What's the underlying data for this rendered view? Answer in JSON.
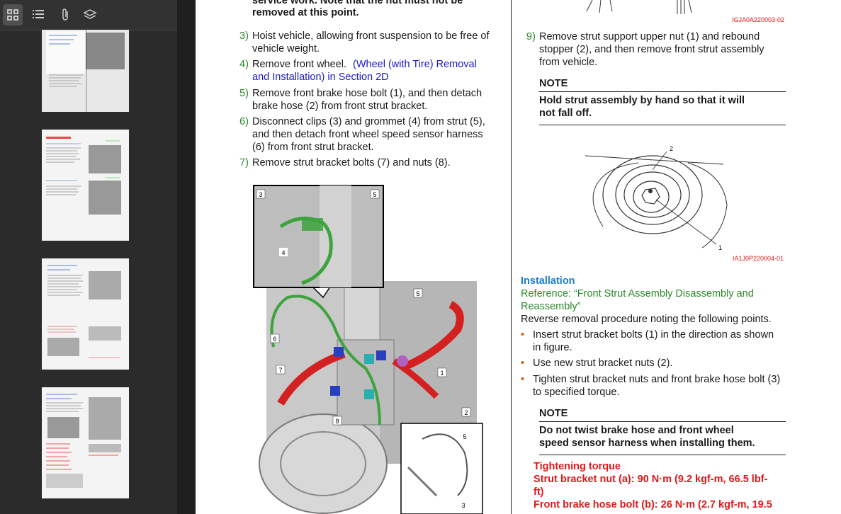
{
  "toolbar": {
    "icons": [
      "thumbnails-icon",
      "outline-icon",
      "attachment-icon",
      "layers-icon"
    ]
  },
  "doc": {
    "top_cut": "service work. Note that the nut must not be",
    "top_bold": "removed at this point.",
    "steps_left": [
      {
        "num": "3)",
        "lines": [
          "Hoist vehicle, allowing front suspension to be free of",
          "vehicle weight."
        ]
      },
      {
        "num": "4)",
        "text": "Remove front wheel.",
        "link1": "(Wheel (with Tire) Removal",
        "link2": "and Installation) in Section 2D"
      },
      {
        "num": "5)",
        "lines": [
          "Remove front brake hose bolt (1), and then detach",
          "brake hose (2) from front strut bracket."
        ]
      },
      {
        "num": "6)",
        "lines": [
          "Disconnect clips (3) and grommet (4) from strut (5),",
          "and then detach front wheel speed sensor harness",
          "(6) from front strut bracket."
        ]
      },
      {
        "num": "7)",
        "lines": [
          "Remove strut bracket bolts (7) and nuts (8)."
        ]
      }
    ],
    "figure_labels": [
      "3",
      "5",
      "4",
      "5",
      "6",
      "7",
      "1",
      "2",
      "8",
      "5",
      "3"
    ],
    "fig_code_top": "IGJA0A220003-02",
    "step9": {
      "num": "9)",
      "lines": [
        "Remove strut support upper nut (1) and rebound",
        "stopper (2), and then remove front strut assembly",
        "from vehicle."
      ]
    },
    "note1": {
      "title": "NOTE",
      "lines": [
        "Hold strut assembly by hand so that it will",
        "not fall off."
      ]
    },
    "fig2_labels": [
      "2",
      "1"
    ],
    "fig_code_mid": "IA1J0P220004-01",
    "install_title": "Installation",
    "reference": [
      "Reference: “Front Strut Assembly Disassembly and",
      "Reassembly”"
    ],
    "reverse": "Reverse removal procedure noting the following points.",
    "bullets": [
      [
        "Insert strut bracket bolts (1) in the direction as shown",
        "in figure."
      ],
      [
        "Use new strut bracket nuts (2)."
      ],
      [
        "Tighten strut bracket nuts and front brake hose bolt (3)",
        "to specified torque."
      ]
    ],
    "note2": {
      "title": "NOTE",
      "lines": [
        "Do not twist brake hose and front wheel",
        "speed sensor harness when installing them."
      ]
    },
    "torque": {
      "title": "Tightening torque",
      "lines": [
        "Strut bracket nut (a):  90 N·m (9.2 kgf-m, 66.5 lbf-",
        "ft)",
        "Front brake hose bolt (b):  26 N·m (2.7 kgf-m, 19.5"
      ]
    }
  }
}
